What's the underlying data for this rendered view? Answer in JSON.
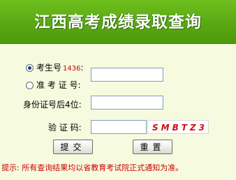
{
  "header": {
    "title": "江西高考成绩录取查询"
  },
  "form": {
    "exam_number": {
      "label": "考生号",
      "hint": "1436",
      "suffix": ":",
      "value": ""
    },
    "ticket_number": {
      "label": "准 考 证 号:",
      "value": ""
    },
    "id_last4": {
      "label": "身份证号后4位:",
      "value": ""
    },
    "captcha": {
      "label": "验 证 码:",
      "value": "",
      "code": "SMBTZ3"
    }
  },
  "buttons": {
    "submit": "提交",
    "reset": "重置"
  },
  "footer": {
    "tip": "提示: 所有查询结果均以省教育考试院正式通知为准。"
  },
  "colors": {
    "banner": "#5aa812",
    "background": "#f6fbdf",
    "accent": "#cc0000"
  }
}
